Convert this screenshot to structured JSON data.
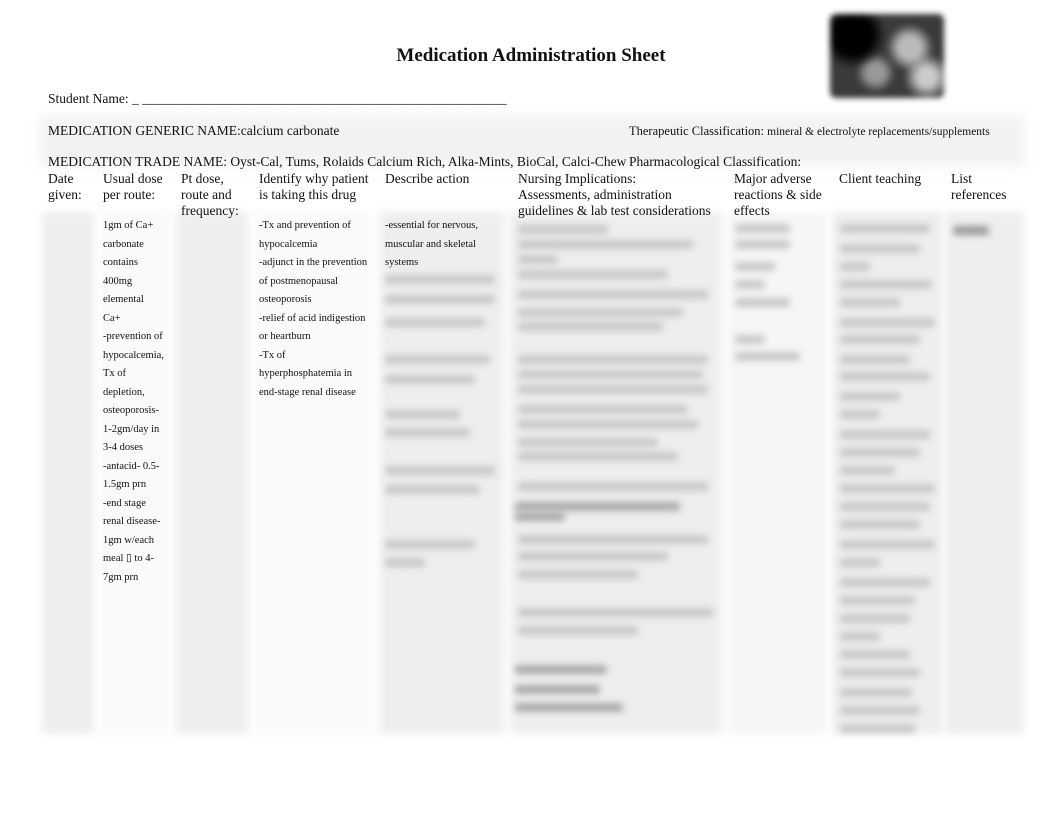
{
  "document": {
    "title": "Medication Administration Sheet",
    "logo_icon": "school-logo-image",
    "student_name_label": "Student Name: _ ______________________________________________________",
    "generic_name_label": "MEDICATION GENERIC NAME:",
    "generic_name_value": "calcium carbonate",
    "therapeutic_label": "Therapeutic Classification: ",
    "therapeutic_value": "mineral & electrolyte replacements/supplements",
    "trade_name_label": "MEDICATION TRADE NAME: ",
    "trade_name_value": "Oyst-Cal, Tums, Rolaids Calcium Rich, Alka-Mints, BioCal, Calci-Chew",
    "pharmacological_label": "Pharmacological Classification:",
    "pharmacological_value": ""
  },
  "table": {
    "headers": [
      {
        "line1": "Date",
        "line2": "given:",
        "line3": ""
      },
      {
        "line1": "Usual dose",
        "line2": "per route:",
        "line3": ""
      },
      {
        "line1": "Pt dose,",
        "line2": "route and",
        "line3": "frequency:"
      },
      {
        "line1": "Identify why patient",
        "line2": "is taking this drug",
        "line3": ""
      },
      {
        "line1": "Describe action",
        "line2": "",
        "line3": ""
      },
      {
        "line1": "Nursing Implications:",
        "line2": "Assessments, administration",
        "line3": "guidelines & lab test considerations"
      },
      {
        "line1": "Major adverse",
        "line2": "reactions & side",
        "line3": "effects"
      },
      {
        "line1": "Client teaching",
        "line2": "",
        "line3": ""
      },
      {
        "line1": "List",
        "line2": "references",
        "line3": ""
      }
    ],
    "usual_dose_lines": [
      "1gm of Ca+",
      "carbonate",
      "contains",
      "400mg",
      "elemental",
      "Ca+",
      "-prevention of",
      "hypocalcemia,",
      "Tx of",
      "depletion,",
      "osteoporosis-",
      "1-2gm/day in",
      "3-4 doses",
      "-antacid- 0.5-",
      "1.5gm prn",
      "-end stage",
      "renal disease-",
      "1gm w/each",
      "meal ▯ to 4-",
      "7gm prn"
    ],
    "indication_lines": [
      "-Tx and prevention of",
      "hypocalcemia",
      "-adjunct in the prevention",
      "of postmenopausal",
      "osteoporosis",
      "-relief of acid indigestion",
      "or heartburn",
      "-Tx of",
      "hyperphosphatemia in",
      "end-stage renal disease"
    ],
    "action_lines": [
      "-essential for nervous,",
      "muscular and skeletal",
      "systems"
    ],
    "blurred_note": "remaining cell contents obscured (blurred preview)"
  }
}
